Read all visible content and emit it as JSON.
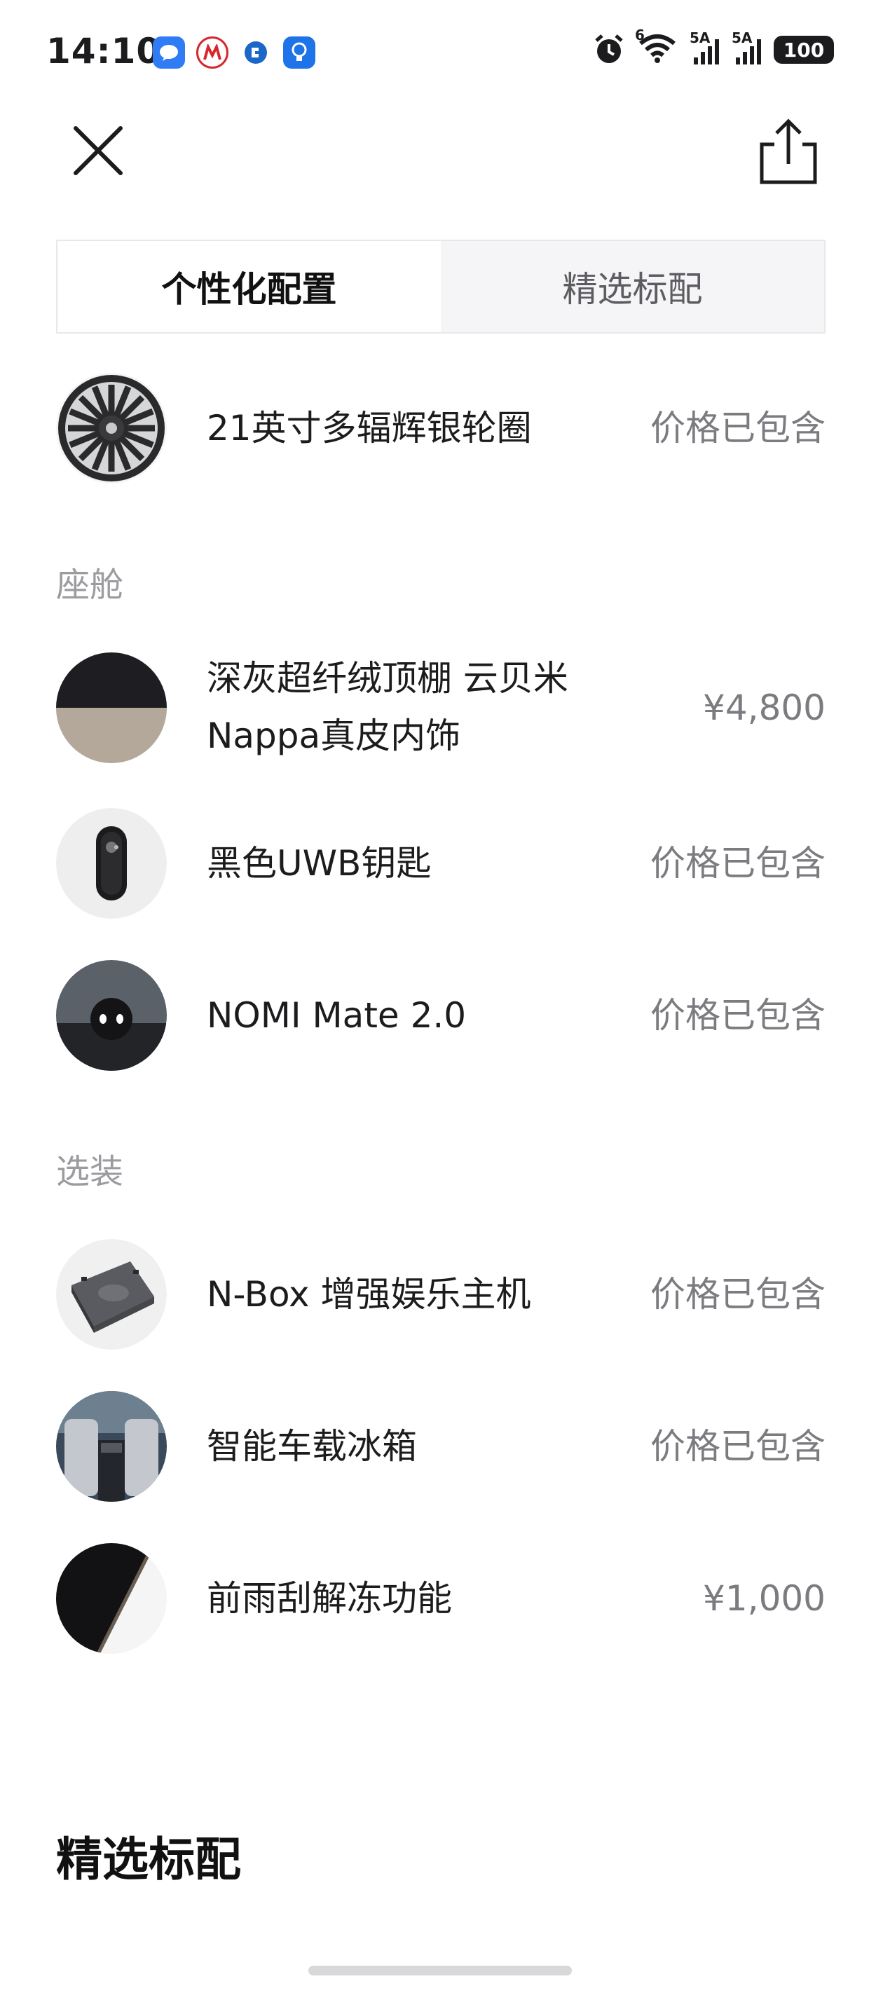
{
  "status_bar": {
    "time": "14:10",
    "signal1_label": "5A",
    "signal2_label": "5A",
    "wifi_label": "6",
    "battery": "100"
  },
  "tabs": [
    {
      "label": "个性化配置"
    },
    {
      "label": "精选标配"
    }
  ],
  "wheel": {
    "name": "21英寸多辐辉银轮圈",
    "price": "价格已包含"
  },
  "sections": {
    "cabin": "座舱",
    "options": "选装"
  },
  "cabin_items": [
    {
      "name_line1": "深灰超纤绒顶棚 云贝米",
      "name_line2": "Nappa真皮内饰",
      "price": "¥4,800"
    },
    {
      "name": "黑色UWB钥匙",
      "price": "价格已包含"
    },
    {
      "name": "NOMI Mate 2.0",
      "price": "价格已包含"
    }
  ],
  "option_items": [
    {
      "name": "N-Box 增强娱乐主机",
      "price": "价格已包含"
    },
    {
      "name": "智能车载冰箱",
      "price": "价格已包含"
    },
    {
      "name": "前雨刮解冻功能",
      "price": "¥1,000"
    }
  ],
  "footer_title": "精选标配"
}
